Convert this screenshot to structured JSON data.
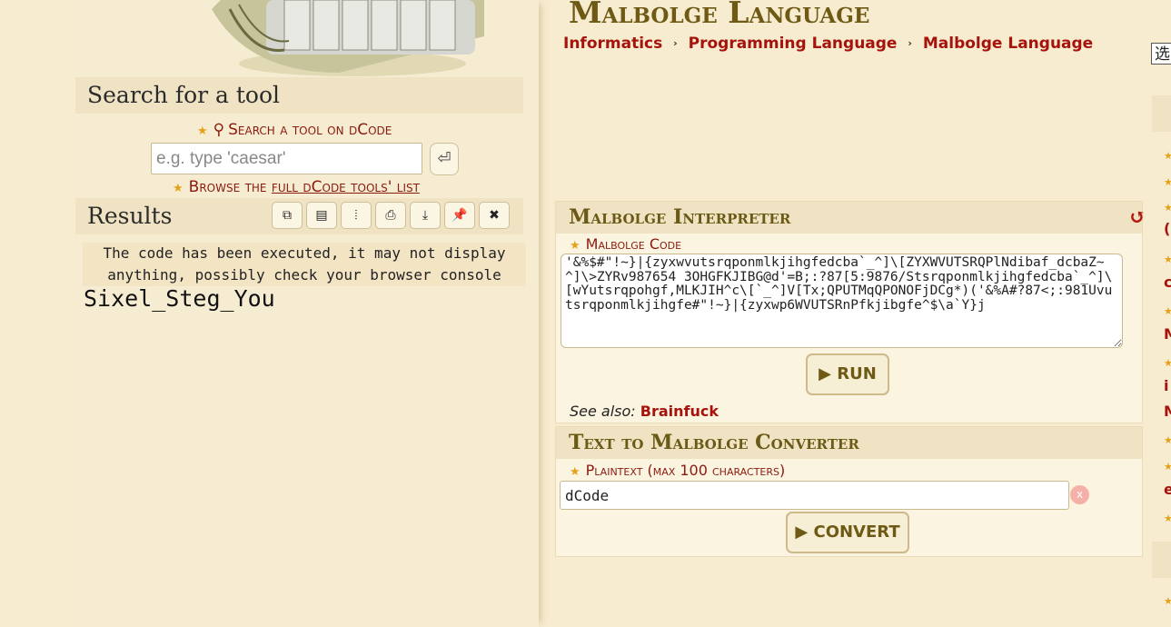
{
  "sidebar": {
    "search_title": "Search for a tool",
    "search_link": "Search a tool on dCode",
    "search_placeholder": "e.g. type 'caesar'",
    "browse_prefix": "Browse the ",
    "browse_underlined": "full dCode tools' list",
    "results_title": "Results",
    "result_note": "The code has been executed, it may not display anything, possibly check your browser console",
    "result_output": "Sixel_Steg_You",
    "toolbar_icons": [
      "copy-icon",
      "clipboard-icon",
      "columns-icon",
      "print-icon",
      "download-icon",
      "pin-icon",
      "close-icon"
    ]
  },
  "main": {
    "title": "Malbolge Language",
    "breadcrumb": [
      "Informatics",
      "Programming Language",
      "Malbolge Language"
    ],
    "interpreter": {
      "title": "Malbolge Interpreter",
      "code_label": "Malbolge Code",
      "code_value": "'&%$#\"!~}|{zyxwvutsrqponmlkjihgfedcba`_^]\\[ZYXWVUTSRQPlNdibaf_dcbaZ~^]\\>ZYRv987654 3OHGFKJIBG@d'=B;:?87[5:9876/Stsrqponmlkjihgfedcba`_^]\\[wYutsrqpohgf,MLKJIH^c\\[`_^]V[Tx;QPUTMqQPONOFjDCg*)('&%A#?87<;:981Uvutsrqponmlkjihgfe#\"!~}|{zyxwp6WVUTSRnPfkjibgfe^$\\a`Y}j",
      "run_label": "RUN",
      "see_also_label": "See also:",
      "see_also_link": "Brainfuck"
    },
    "converter": {
      "title": "Text to Malbolge Converter",
      "plaintext_label": "Plaintext (max 100 characters)",
      "plaintext_value": "dCode",
      "clear_label": "x",
      "convert_label": "CONVERT"
    }
  },
  "right_edge": {
    "box_text": "选",
    "letters": [
      "(",
      "c",
      "M",
      "i",
      "M",
      "e"
    ]
  }
}
